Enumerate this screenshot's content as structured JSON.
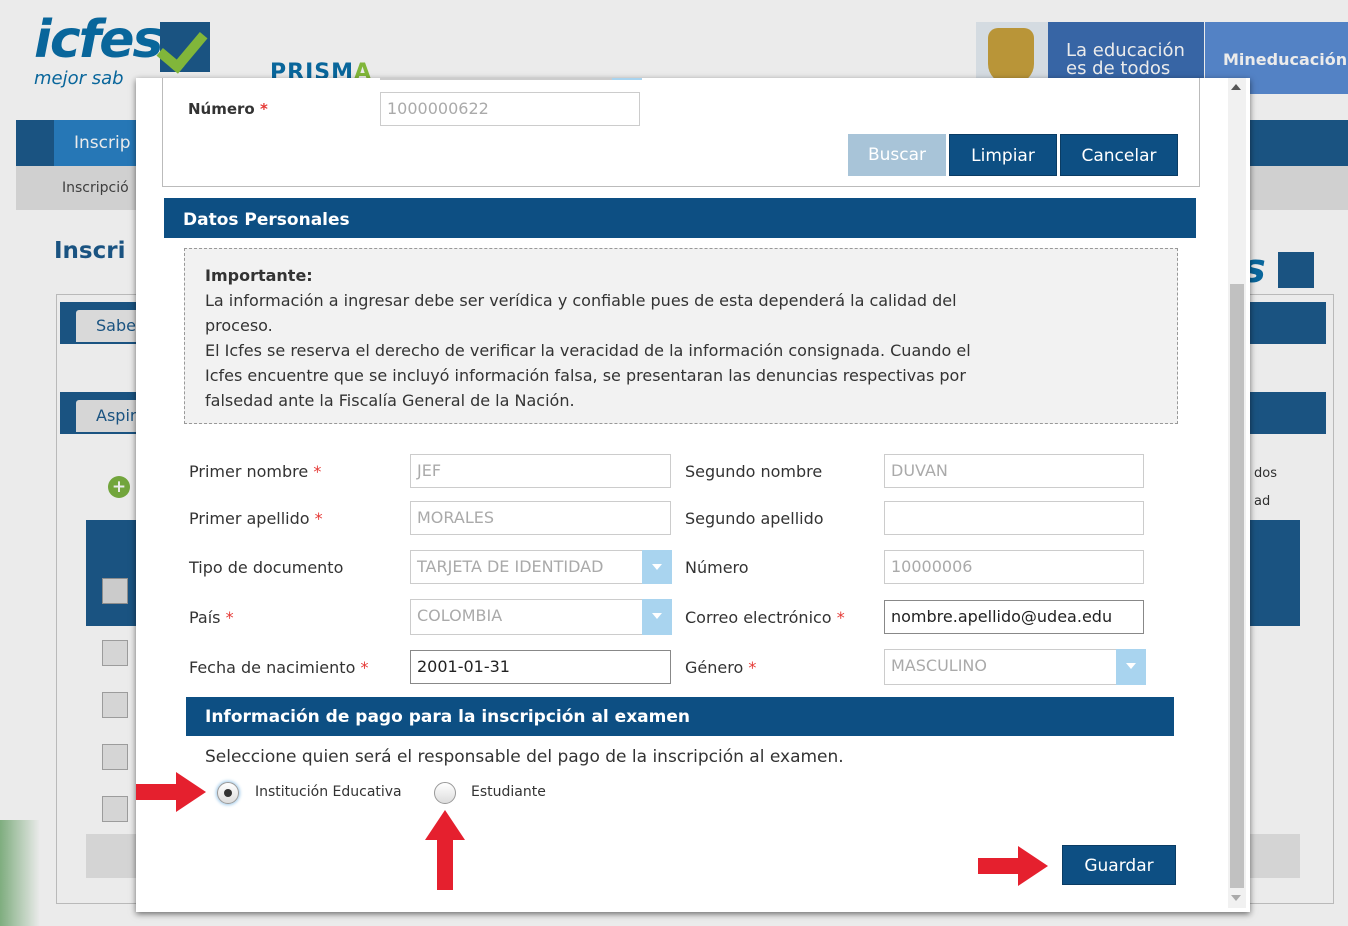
{
  "header": {
    "logo_text": "icfes",
    "logo_sub": "mejor sab",
    "prisma": "PRISM",
    "prisma_a": "A",
    "gov_educacion": "La educación es de todos",
    "gov_min": "Mineducación"
  },
  "nav": {
    "tab": "Inscrip",
    "breadcrumb": "Inscripció"
  },
  "page": {
    "title": "Inscri",
    "panel1_tab": "Sabe",
    "panel2_tab": "Aspir",
    "right_text_1": "dos",
    "right_text_2": "ad"
  },
  "search": {
    "numero_label": "Número",
    "numero_value": "1000000622",
    "buscar": "Buscar",
    "limpiar": "Limpiar",
    "cancelar": "Cancelar"
  },
  "personal": {
    "section_title": "Datos Personales",
    "notice_title": "Importante:",
    "notice_l1": "La información a ingresar debe ser verídica y confiable pues de esta dependerá la calidad del",
    "notice_l2": "proceso.",
    "notice_l3": "El Icfes se reserva el derecho de verificar la veracidad de la información consignada. Cuando el",
    "notice_l4": "Icfes encuentre que se incluyó información falsa, se presentaran las denuncias respectivas por",
    "notice_l5": "falsedad ante la Fiscalía General de la Nación.",
    "primer_nombre_label": "Primer nombre",
    "primer_nombre": "JEF",
    "segundo_nombre_label": "Segundo nombre",
    "segundo_nombre": "DUVAN",
    "primer_apellido_label": "Primer apellido",
    "primer_apellido": "MORALES",
    "segundo_apellido_label": "Segundo apellido",
    "segundo_apellido": "",
    "tipo_doc_label": "Tipo de documento",
    "tipo_doc": "TARJETA DE IDENTIDAD",
    "numero_label": "Número",
    "numero": "10000006",
    "pais_label": "País",
    "pais": "COLOMBIA",
    "correo_label": "Correo electrónico",
    "correo": "nombre.apellido@udea.edu",
    "fecha_label": "Fecha de nacimiento",
    "fecha": "2001-01-31",
    "genero_label": "Género",
    "genero": "MASCULINO",
    "required_mark": "*"
  },
  "payment": {
    "section_title": "Información de pago para la inscripción al examen",
    "instruction": "Seleccione quien será el responsable del pago de la inscripción al examen.",
    "option_institucion": "Institución Educativa",
    "option_estudiante": "Estudiante",
    "selected": "Institución Educativa"
  },
  "actions": {
    "guardar": "Guardar"
  },
  "colors": {
    "primary": "#0d4f83",
    "annotation_arrow": "#e5202e",
    "required": "#e53935"
  }
}
